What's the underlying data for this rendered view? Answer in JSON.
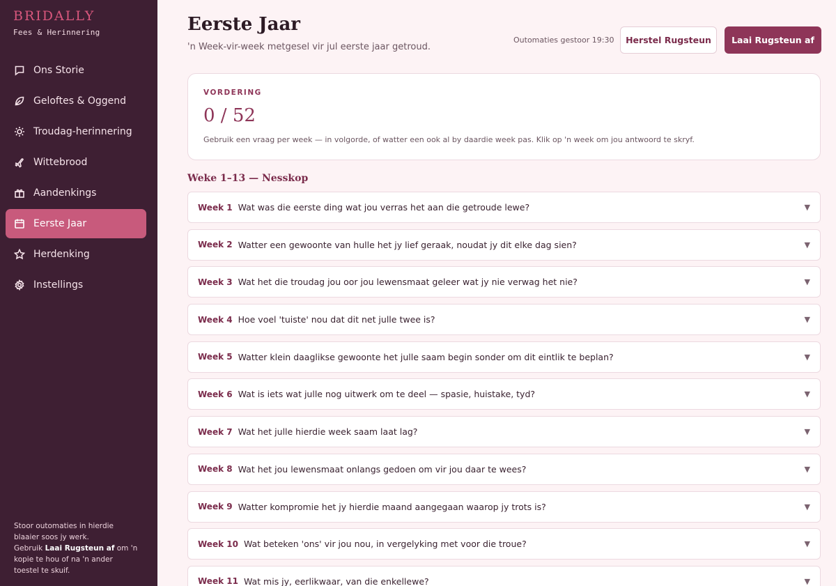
{
  "brand": {
    "name": "BRIDALLY",
    "tagline": "Fees & Herinnering"
  },
  "sidebar": {
    "items": [
      {
        "label": "Ons Storie",
        "icon": "chat-icon",
        "active": false
      },
      {
        "label": "Geloftes & Oggend",
        "icon": "leaf-icon",
        "active": false
      },
      {
        "label": "Troudag-herinnering",
        "icon": "sun-icon",
        "active": false
      },
      {
        "label": "Wittebrood",
        "icon": "plane-icon",
        "active": false
      },
      {
        "label": "Aandenkings",
        "icon": "gift-icon",
        "active": true
      },
      {
        "label": "Eerste Jaar",
        "icon": "calendar-icon",
        "active": true
      },
      {
        "label": "Herdenking",
        "icon": "star-icon",
        "active": false
      },
      {
        "label": "Instellings",
        "icon": "gear-icon",
        "active": false
      }
    ],
    "note_line1": "Stoor outomaties in hierdie blaaier soos jy werk.",
    "note_prefix": "Gebruik ",
    "note_bold": "Laai Rugsteun af",
    "note_suffix": " om 'n kopie te hou of na 'n ander toestel te skuif."
  },
  "header": {
    "title": "Eerste Jaar",
    "subtitle": "'n Week-vir-week metgesel vir jul eerste jaar getroud.",
    "saved_status": "Outomaties gestoor 19:30",
    "restore_label": "Herstel Rugsteun",
    "download_label": "Laai Rugsteun af"
  },
  "progress": {
    "label": "VORDERING",
    "value": "0 / 52",
    "help": "Gebruik een vraag per week — in volgorde, of watter een ook al by daardie week pas. Klik op 'n week om jou antwoord te skryf."
  },
  "section": {
    "heading": "Weke 1–13 — Nesskop"
  },
  "weeks": [
    {
      "num": "Week 1",
      "question": "Wat was die eerste ding wat jou verras het aan die getroude lewe?"
    },
    {
      "num": "Week 2",
      "question": "Watter een gewoonte van hulle het jy lief geraak, noudat jy dit elke dag sien?"
    },
    {
      "num": "Week 3",
      "question": "Wat het die troudag jou oor jou lewensmaat geleer wat jy nie verwag het nie?"
    },
    {
      "num": "Week 4",
      "question": "Hoe voel 'tuiste' nou dat dit net julle twee is?"
    },
    {
      "num": "Week 5",
      "question": "Watter klein daaglikse gewoonte het julle saam begin sonder om dit eintlik te beplan?"
    },
    {
      "num": "Week 6",
      "question": "Wat is iets wat julle nog uitwerk om te deel — spasie, huistake, tyd?"
    },
    {
      "num": "Week 7",
      "question": "Wat het julle hierdie week saam laat lag?"
    },
    {
      "num": "Week 8",
      "question": "Wat het jou lewensmaat onlangs gedoen om vir jou daar te wees?"
    },
    {
      "num": "Week 9",
      "question": "Watter kompromie het jy hierdie maand aangegaan waarop jy trots is?"
    },
    {
      "num": "Week 10",
      "question": "Wat beteken 'ons' vir jou nou, in vergelyking met voor die troue?"
    },
    {
      "num": "Week 11",
      "question": "Wat mis jy, eerlikwaar, van die enkellewe?"
    }
  ]
}
